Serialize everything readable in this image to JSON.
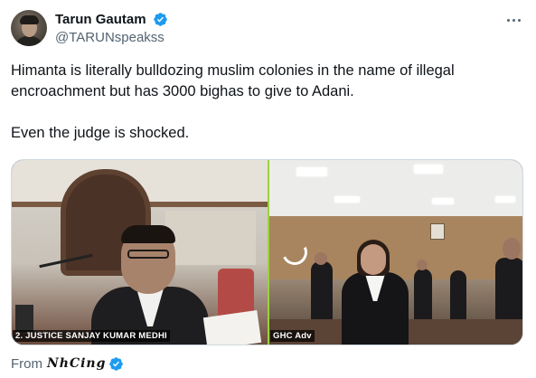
{
  "tweet": {
    "author": {
      "display_name": "Tarun Gautam",
      "handle": "@TARUNspeakss",
      "verified": true
    },
    "text_paragraphs": [
      "Himanta is literally bulldozing muslim colonies in the name of illegal encroachment but has 3000 bighas to give to Adani.",
      "Even the judge is shocked."
    ],
    "media": {
      "left_caption": "2. JUSTICE SANJAY KUMAR MEDHI",
      "right_caption": "GHC Adv"
    },
    "footer": {
      "from_label": "From",
      "source_name": "NhCing",
      "source_verified": true
    }
  },
  "icons": {
    "more": "more-horizontal-icon",
    "verified": "verified-badge-icon",
    "loading": "loading-spinner-icon"
  },
  "colors": {
    "verified_blue": "#1d9bf0",
    "secondary_text": "#536471",
    "primary_text": "#0f1419",
    "video_divider": "#9bd23c"
  }
}
